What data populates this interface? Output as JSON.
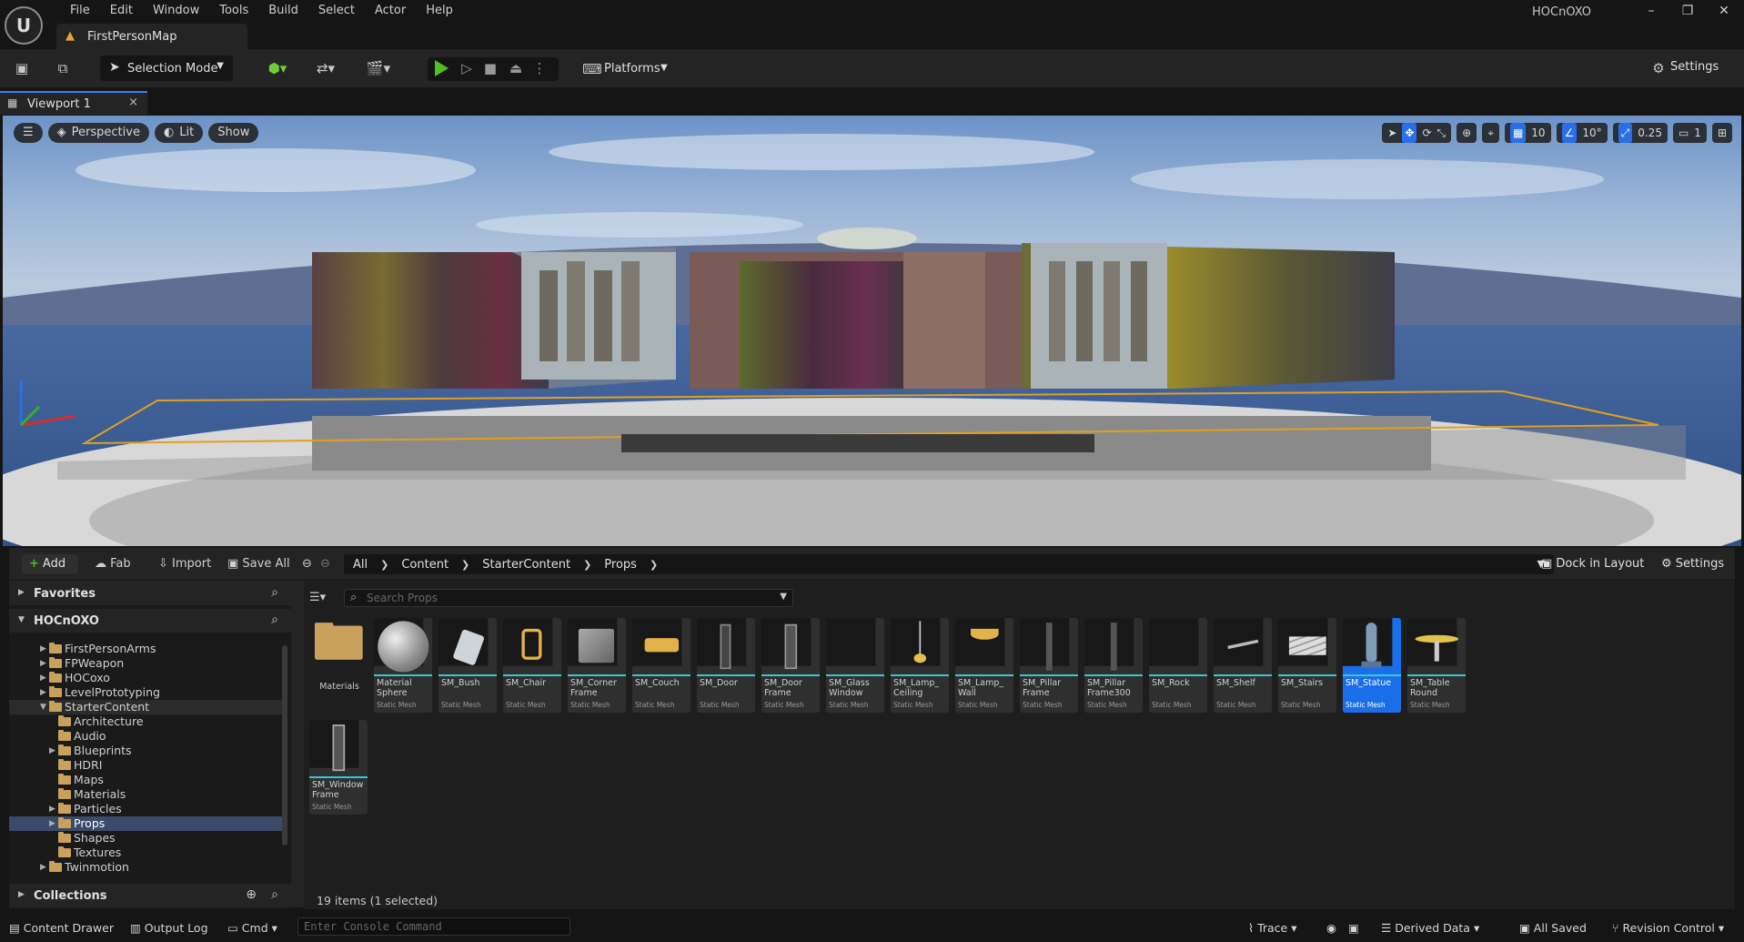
{
  "app": {
    "project_name": "HOCnOXO",
    "logo_text": "U"
  },
  "menu": [
    "File",
    "Edit",
    "Window",
    "Tools",
    "Build",
    "Select",
    "Actor",
    "Help"
  ],
  "level_tab": {
    "label": "FirstPersonMap"
  },
  "toolbar": {
    "selection_mode": "Selection Mode",
    "platforms": "Platforms",
    "settings": "Settings"
  },
  "viewport_tab": {
    "label": "Viewport 1"
  },
  "viewport": {
    "perspective": "Perspective",
    "lit": "Lit",
    "show": "Show",
    "grid_snap": "10",
    "rotation_snap": "10°",
    "scale_snap": "0.25",
    "camera_speed": "1"
  },
  "content_browser": {
    "add": "Add",
    "fab": "Fab",
    "import": "Import",
    "save_all": "Save All",
    "breadcrumb": [
      "All",
      "Content",
      "StarterContent",
      "Props"
    ],
    "dock_in_layout": "Dock in Layout",
    "settings": "Settings",
    "search_placeholder": "Search Props",
    "item_count": "19 items (1 selected)"
  },
  "sources": {
    "favorites": "Favorites",
    "root": "HOCnOXO",
    "collections": "Collections",
    "tree": [
      {
        "name": "FirstPersonArms",
        "depth": 1,
        "arrow": true
      },
      {
        "name": "FPWeapon",
        "depth": 1,
        "arrow": true
      },
      {
        "name": "HOCoxo",
        "depth": 1,
        "arrow": true
      },
      {
        "name": "LevelPrototyping",
        "depth": 1,
        "arrow": true
      },
      {
        "name": "StarterContent",
        "depth": 1,
        "arrow": true,
        "open": true
      },
      {
        "name": "Architecture",
        "depth": 2,
        "arrow": false
      },
      {
        "name": "Audio",
        "depth": 2,
        "arrow": false
      },
      {
        "name": "Blueprints",
        "depth": 2,
        "arrow": true
      },
      {
        "name": "HDRI",
        "depth": 2,
        "arrow": false
      },
      {
        "name": "Maps",
        "depth": 2,
        "arrow": false
      },
      {
        "name": "Materials",
        "depth": 2,
        "arrow": false
      },
      {
        "name": "Particles",
        "depth": 2,
        "arrow": true
      },
      {
        "name": "Props",
        "depth": 2,
        "arrow": true,
        "selected": true
      },
      {
        "name": "Shapes",
        "depth": 2,
        "arrow": false
      },
      {
        "name": "Textures",
        "depth": 2,
        "arrow": false
      },
      {
        "name": "Twinmotion",
        "depth": 1,
        "arrow": true
      }
    ]
  },
  "assets": [
    {
      "name": "Materials",
      "type": "",
      "kind": "folder"
    },
    {
      "name": "Material Sphere",
      "type": "Static Mesh",
      "kind": "sphere"
    },
    {
      "name": "SM_Bush",
      "type": "Static Mesh",
      "kind": "bush"
    },
    {
      "name": "SM_Chair",
      "type": "Static Mesh",
      "kind": "chair"
    },
    {
      "name": "SM_Corner Frame",
      "type": "Static Mesh",
      "kind": "box"
    },
    {
      "name": "SM_Couch",
      "type": "Static Mesh",
      "kind": "couch"
    },
    {
      "name": "SM_Door",
      "type": "Static Mesh",
      "kind": "door"
    },
    {
      "name": "SM_Door Frame",
      "type": "Static Mesh",
      "kind": "doorframe"
    },
    {
      "name": "SM_Glass Window",
      "type": "Static Mesh",
      "kind": "empty"
    },
    {
      "name": "SM_Lamp_ Ceiling",
      "type": "Static Mesh",
      "kind": "lampceiling"
    },
    {
      "name": "SM_Lamp_ Wall",
      "type": "Static Mesh",
      "kind": "lampwall"
    },
    {
      "name": "SM_Pillar Frame",
      "type": "Static Mesh",
      "kind": "pillar"
    },
    {
      "name": "SM_Pillar Frame300",
      "type": "Static Mesh",
      "kind": "pillar"
    },
    {
      "name": "SM_Rock",
      "type": "Static Mesh",
      "kind": "empty"
    },
    {
      "name": "SM_Shelf",
      "type": "Static Mesh",
      "kind": "shelf"
    },
    {
      "name": "SM_Stairs",
      "type": "Static Mesh",
      "kind": "stairs"
    },
    {
      "name": "SM_Statue",
      "type": "Static Mesh",
      "kind": "statue",
      "selected": true
    },
    {
      "name": "SM_Table Round",
      "type": "Static Mesh",
      "kind": "table"
    },
    {
      "name": "SM_Window Frame",
      "type": "Static Mesh",
      "kind": "window"
    }
  ],
  "statusbar": {
    "content_drawer": "Content Drawer",
    "output_log": "Output Log",
    "cmd": "Cmd",
    "console_placeholder": "Enter Console Command",
    "trace": "Trace",
    "derived_data": "Derived Data",
    "all_saved": "All Saved",
    "revision_control": "Revision Control"
  }
}
